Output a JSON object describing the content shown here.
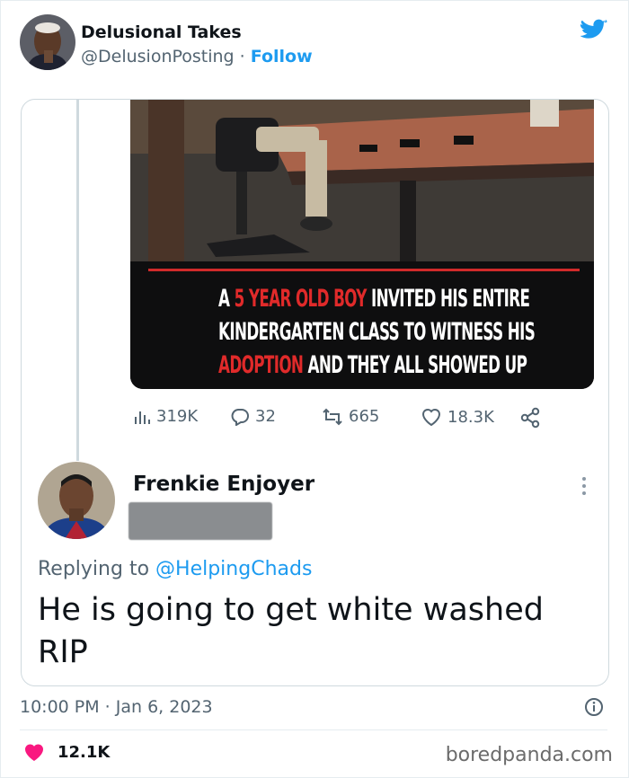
{
  "tweet": {
    "author_name": "Delusional Takes",
    "author_handle": "@DelusionPosting",
    "separator": "·",
    "follow_label": "Follow",
    "timestamp": "10:00 PM · Jan 6, 2023",
    "likes": "12.1K"
  },
  "quoted_media": {
    "line1_white_a": "A ",
    "line1_red": "5 YEAR OLD BOY",
    "line1_white_b": " INVITED HIS ENTIRE",
    "line2": "KINDERGARTEN CLASS TO WITNESS HIS",
    "line3_red": "ADOPTION",
    "line3_white": " AND THEY ALL SHOWED UP"
  },
  "quoted_stats": {
    "views": "319K",
    "replies": "32",
    "retweets": "665",
    "likes": "18.3K"
  },
  "reply": {
    "author_name": "Frenkie Enjoyer",
    "replying_prefix": "Replying to ",
    "replying_to": "@HelpingChads",
    "text_line1": "He is going to get white washed",
    "text_line2": "RIP"
  },
  "watermark": "boredpanda.com",
  "colors": {
    "accent": "#1d9bf0",
    "like_red": "#f91880",
    "overlay_red": "#e02a2a"
  }
}
